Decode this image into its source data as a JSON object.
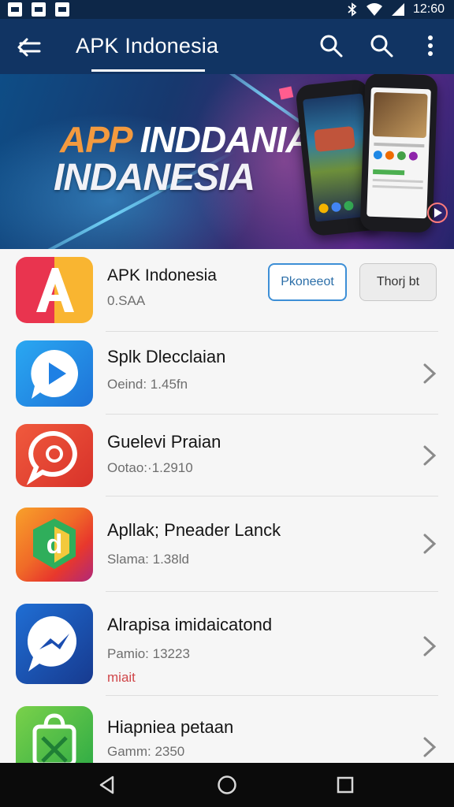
{
  "status_bar": {
    "time": "12:60",
    "left_icons": [
      "image-icon",
      "image-icon",
      "store-icon"
    ],
    "right_icons": [
      "bluetooth-icon",
      "wifi-icon",
      "signal-icon"
    ]
  },
  "app_bar": {
    "title": "APK Indonesia",
    "icons": [
      "back-icon",
      "search-icon",
      "search-icon",
      "more-vert-icon"
    ]
  },
  "banner": {
    "line1_highlight": "APP",
    "line1_rest": " INDDANIA",
    "line2": "INDANESIA"
  },
  "list": [
    {
      "title": "APK Indonesia",
      "subtitle": "0.SAA",
      "primary_button": "Pkoneeot",
      "secondary_button": "Thorj bt",
      "icon": "letter-a-icon",
      "icon_colors": [
        "#e9344f",
        "#f9b531"
      ]
    },
    {
      "title": "Splk Dlecclaian",
      "subtitle": "Oeind: 1.45fn",
      "icon": "play-bubble-icon",
      "icon_colors": [
        "#1e8fe6",
        "#2aa8f2"
      ]
    },
    {
      "title": "Guelevi Praian",
      "subtitle": "Ootao:·1.2910",
      "icon": "chat-bubble-icon",
      "icon_colors": [
        "#e53c2f",
        "#f05a3d"
      ]
    },
    {
      "title": "Apllak; Pneader Lanck",
      "subtitle": "Slama: 1.38ld",
      "icon": "letter-d-icon",
      "icon_colors": [
        "#e8382c",
        "#f8a12a"
      ]
    },
    {
      "title": "Alrapisa imidaicatond",
      "subtitle": "Pamio: 13223",
      "extra": "miait",
      "icon": "messenger-icon",
      "icon_colors": [
        "#1455b8",
        "#1d3a9b"
      ]
    },
    {
      "title": "Hiapniea petaan",
      "subtitle": "Gamm: 2350",
      "icon": "shopping-bag-icon",
      "icon_colors": [
        "#28a845",
        "#7ad14a"
      ]
    }
  ],
  "nav_bar": {
    "icons": [
      "back-triangle-icon",
      "home-circle-icon",
      "recents-square-icon"
    ]
  }
}
